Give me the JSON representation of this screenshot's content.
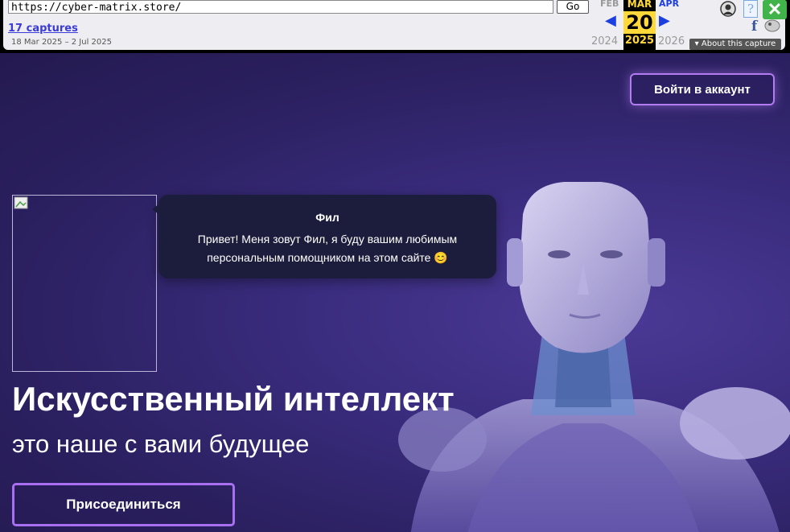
{
  "wayback": {
    "url": "https://cyber-matrix.store/",
    "go_label": "Go",
    "captures_label": "17 captures",
    "date_range": "18 Mar 2025 – 2 Jul 2025",
    "prev_month": "FEB",
    "current_month": "MAR",
    "next_month": "APR",
    "current_day": "20",
    "prev_year": "2024",
    "current_year": "2025",
    "next_year": "2026",
    "about_label": "About this capture",
    "prev_arrow": "◀",
    "next_arrow": "▶",
    "close_glyph": "✕",
    "help_glyph": "?",
    "facebook_glyph": "f",
    "about_arrow": "▾"
  },
  "hero": {
    "login_label": "Войти в аккаунт",
    "assistant_name": "Фил",
    "assistant_message": "Привет! Меня зовут Фил, я буду вашим любимым персональным помощником на этом сайте 😊",
    "title": "Искусственный интеллект",
    "subtitle": "это наше с вами будущее",
    "join_label": "Присоединиться"
  },
  "colors": {
    "accent_border": "#b27cf0",
    "hero_bg": "#2b2060",
    "bubble_bg": "#1c1d3c",
    "wayback_link": "#3b3bd8",
    "wayback_highlight": "#ffd83a"
  }
}
